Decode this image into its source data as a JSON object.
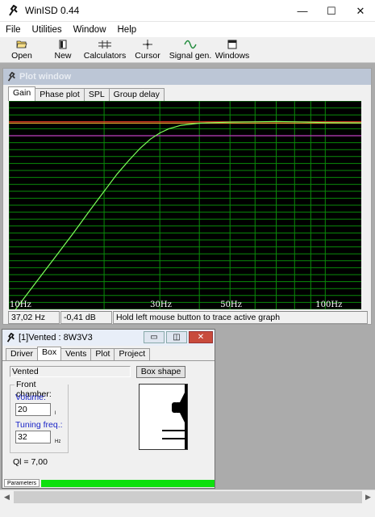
{
  "app": {
    "title": "WinISD 0.44"
  },
  "window_controls": {
    "minimize": "—",
    "maximize": "☐",
    "close": "✕"
  },
  "menu": [
    "File",
    "Utilities",
    "Window",
    "Help"
  ],
  "toolbar": [
    "Open",
    "New",
    "Calculators",
    "Cursor",
    "Signal gen.",
    "Windows"
  ],
  "plot_window": {
    "title": "Plot window",
    "tabs": [
      "Gain",
      "Phase plot",
      "SPL",
      "Group delay"
    ],
    "active_tab": "Gain",
    "status": [
      "37,02 Hz",
      "-0,41 dB",
      "Hold left mouse button to trace active graph"
    ]
  },
  "chart_data": {
    "type": "line",
    "title": "",
    "xlabel": "",
    "ylabel": "",
    "x_scale": "log",
    "xlim": [
      10,
      130
    ],
    "x_tick_labels": [
      "10Hz",
      "30Hz",
      "50Hz",
      "100Hz"
    ],
    "ylim": [
      -27,
      3
    ],
    "grid": true,
    "colors": {
      "background": "#000000",
      "grid": "#0a8a0a",
      "curve": "#7cff5a",
      "ref_red": "#ff2a2a",
      "ref_orange": "#d89a2a",
      "ref_magenta": "#c040c0"
    },
    "reference_lines": [
      {
        "color": "ref_red",
        "y": 0
      },
      {
        "color": "ref_orange",
        "y": -0.2
      },
      {
        "color": "ref_magenta",
        "y": -2
      }
    ],
    "series": [
      {
        "x": [
          10.5,
          12,
          14,
          16,
          18,
          20,
          22,
          24,
          26,
          28,
          30,
          32,
          35,
          40,
          45,
          50,
          60,
          70,
          80,
          100,
          130
        ],
        "y": [
          -27,
          -23.5,
          -19.5,
          -16,
          -12.8,
          -10,
          -7.5,
          -5.5,
          -3.8,
          -2.5,
          -1.6,
          -1,
          -0.5,
          -0.2,
          -0.1,
          -0.05,
          0,
          0.05,
          0,
          -0.1,
          -0.15
        ]
      }
    ]
  },
  "box_window": {
    "title": "[1]Vented : 8W3V3",
    "title_buttons": [
      "▭",
      "◫",
      "✕"
    ],
    "tabs": [
      "Driver",
      "Box",
      "Vents",
      "Plot",
      "Project"
    ],
    "active_tab": "Box",
    "box_type": "Vented",
    "box_shape_button": "Box shape",
    "group_label": "Front chamber:",
    "volume_label": "Volume:",
    "volume_value": "20",
    "volume_unit": "l",
    "tuning_label": "Tuning freq.:",
    "tuning_value": "32",
    "tuning_unit": "Hz",
    "ql": "Ql = 7,00",
    "footer_tab": "Parameters"
  },
  "scroll": {
    "left": "◀",
    "right": "▶"
  }
}
